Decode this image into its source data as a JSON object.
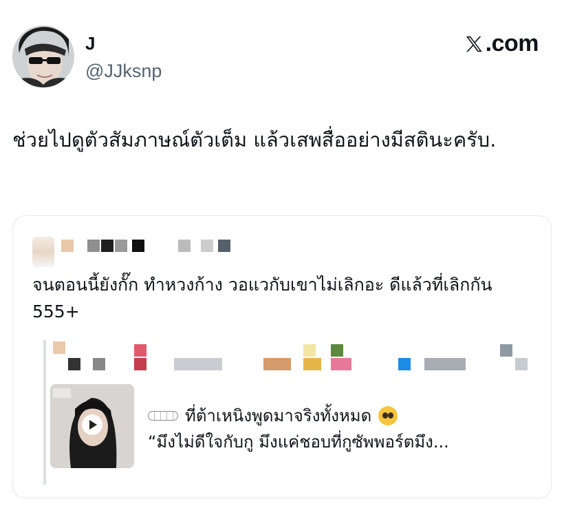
{
  "author": {
    "display_name": "J",
    "handle": "@JJksnp"
  },
  "brand": {
    "label": ".com",
    "icon": "x-logo-icon"
  },
  "tweet": {
    "text": "ช่วยไปดูตัวสัมภาษณ์ตัวเต็ม แล้วเสพสื่ออย่างมีสตินะครับ."
  },
  "quoted": {
    "text": "จนตอนนี้ยังกั๊ก ทำหวงก้าง วอแวกับเขาไม่เลิกอะ ดีแล้วที่เลิกกัน 555+",
    "nested": {
      "line1": "ที่ต้าเหนิงพูดมาจริงทั้งหมด",
      "line2": "“มึงไม่ดีใจกับกู มึงแค่ชอบที่กูซัพพอร์ตมึง...",
      "emoji": "pleading-face-emoji",
      "thumbnail": "video-thumbnail"
    }
  },
  "colors": {
    "text": "#0f1419",
    "secondary": "#536471",
    "border": "#e3e6e8"
  }
}
